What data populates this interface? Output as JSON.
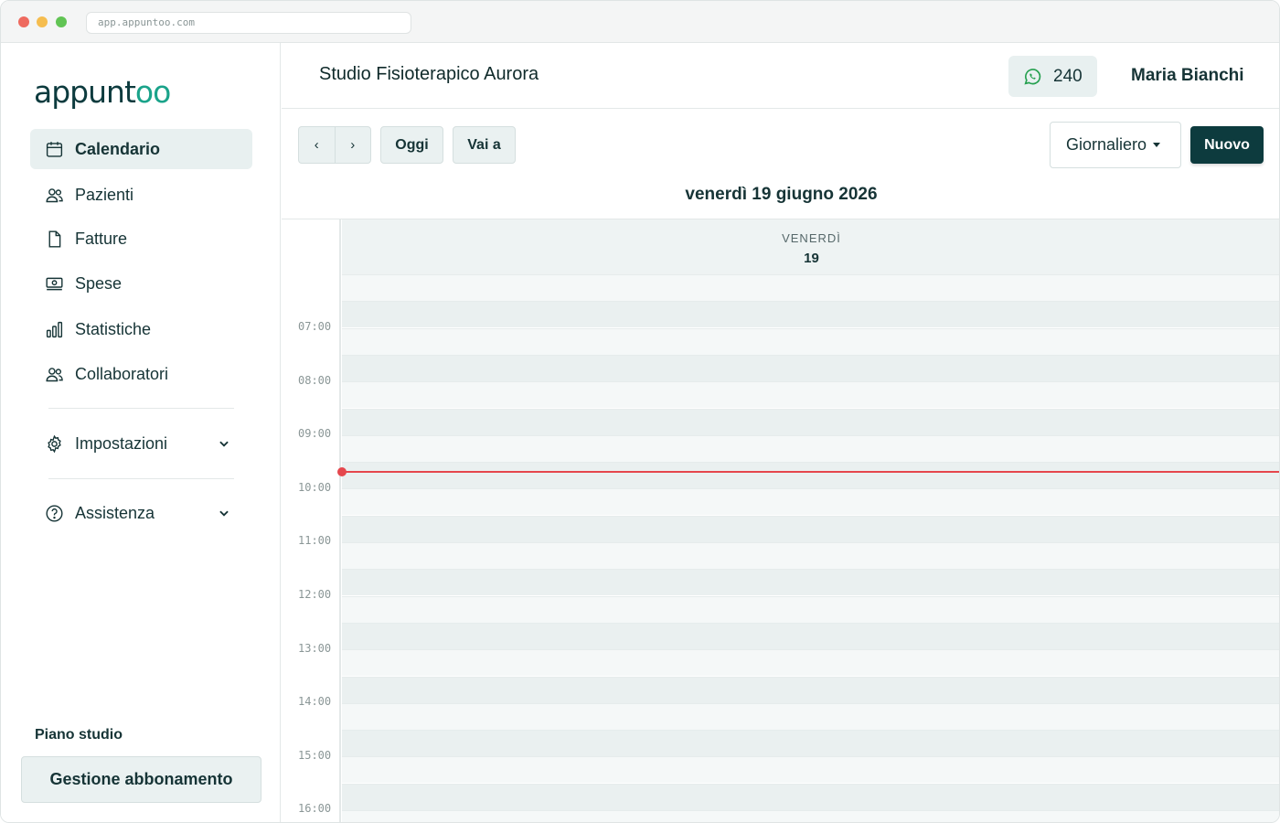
{
  "browser": {
    "url": "app.appuntoo.com"
  },
  "sidebar": {
    "logo_main": "appunt",
    "logo_accent": "oo",
    "items": [
      {
        "label": "Calendario",
        "icon": "calendar-icon",
        "active": true
      },
      {
        "label": "Pazienti",
        "icon": "users-icon",
        "active": false
      },
      {
        "label": "Fatture",
        "icon": "document-icon",
        "active": false
      },
      {
        "label": "Spese",
        "icon": "money-icon",
        "active": false
      },
      {
        "label": "Statistiche",
        "icon": "chart-icon",
        "active": false
      },
      {
        "label": "Collaboratori",
        "icon": "users-icon",
        "active": false
      }
    ],
    "settings_label": "Impostazioni",
    "support_label": "Assistenza",
    "plan_label": "Piano studio",
    "plan_button": "Gestione abbonamento"
  },
  "header": {
    "studio_name": "Studio Fisioterapico Aurora",
    "whatsapp_count": "240",
    "user_name": "Maria Bianchi"
  },
  "toolbar": {
    "prev": "‹",
    "next": "›",
    "today": "Oggi",
    "goto": "Vai a",
    "view": "Giornaliero",
    "new": "Nuovo",
    "date_title": "venerdì 19 giugno 2026"
  },
  "calendar": {
    "day_name": "VENERDÌ",
    "day_number": "19",
    "hours": [
      "07:00",
      "08:00",
      "09:00",
      "10:00",
      "11:00",
      "12:00",
      "13:00",
      "14:00",
      "15:00",
      "16:00"
    ]
  },
  "colors": {
    "brand": "#0d3b3e",
    "accent": "#1aa38a",
    "now_line": "#e5474d",
    "whatsapp": "#25a04f"
  }
}
